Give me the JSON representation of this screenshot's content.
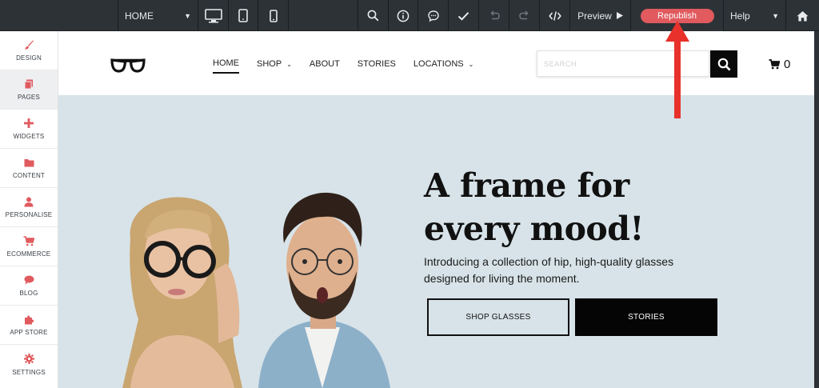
{
  "toolbar": {
    "page_select": "HOME",
    "icons": {
      "desktop": "desktop-icon",
      "tablet": "tablet-icon",
      "mobile": "mobile-icon",
      "search": "search-icon",
      "info": "info-icon",
      "comments": "comment-icon",
      "check": "check-icon",
      "undo": "undo-icon",
      "redo": "redo-icon",
      "code": "code-icon",
      "home": "home-icon"
    },
    "preview_label": "Preview",
    "republish_label": "Republish",
    "help_label": "Help",
    "republish_color": "#e05a5e"
  },
  "sidebar": {
    "items": [
      {
        "label": "DESIGN",
        "icon": "brush-icon"
      },
      {
        "label": "PAGES",
        "icon": "pages-icon"
      },
      {
        "label": "WIDGETS",
        "icon": "plus-icon"
      },
      {
        "label": "CONTENT",
        "icon": "folder-icon"
      },
      {
        "label": "PERSONALISE",
        "icon": "person-icon"
      },
      {
        "label": "ECOMMERCE",
        "icon": "cart-icon"
      },
      {
        "label": "BLOG",
        "icon": "chat-icon"
      },
      {
        "label": "APP STORE",
        "icon": "puzzle-icon"
      },
      {
        "label": "SETTINGS",
        "icon": "gear-icon"
      }
    ],
    "accent_color": "#e05a5e"
  },
  "site": {
    "nav": [
      "HOME",
      "SHOP",
      "ABOUT",
      "STORIES",
      "LOCATIONS"
    ],
    "search_placeholder": "SEARCH",
    "cart_count": "0",
    "hero": {
      "title_line1": "A frame for",
      "title_line2": "every mood!",
      "subtitle_line1": "Introducing a collection of hip, high-quality glasses",
      "subtitle_line2": "designed for living the moment.",
      "button_primary": "SHOP GLASSES",
      "button_secondary": "STORIES"
    },
    "hero_bg": "#d7e3e8"
  }
}
